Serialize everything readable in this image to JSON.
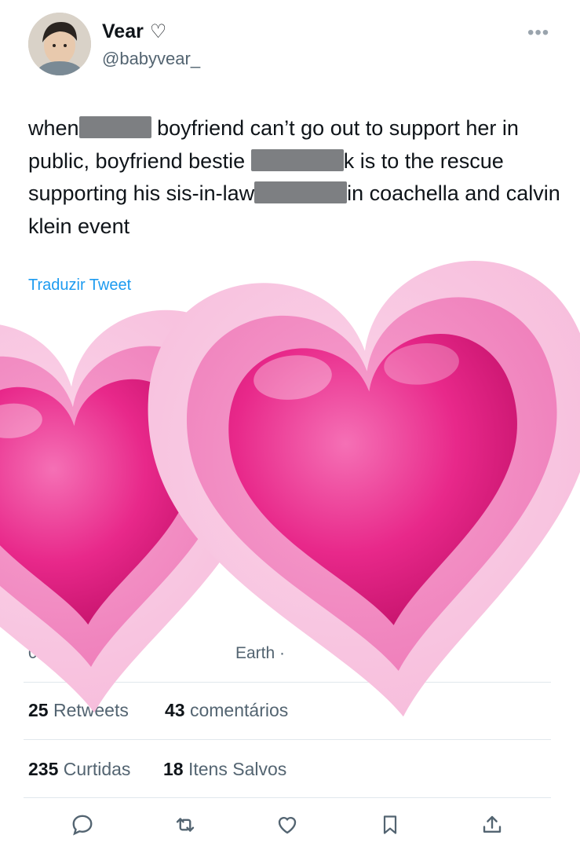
{
  "user": {
    "name": "Vear",
    "handle": "@babyvear_",
    "heart_symbol": "♡"
  },
  "more_label": "•••",
  "tweet": {
    "p1": "when",
    "p2": "boyfriend can’t go out to support her in public, boyfriend bestie",
    "p3": "k is to the rescue supporting his sis-in-law",
    "p4": "in coachella and calvin klein event"
  },
  "translate_label": "Traduzir Tweet",
  "meta": {
    "time_fragment": "07:",
    "source_fragment": "Earth ·"
  },
  "stats": {
    "retweets_count": "25",
    "retweets_label": "Retweets",
    "comments_count": "43",
    "comments_label": "comentários",
    "likes_count": "235",
    "likes_label": "Curtidas",
    "saves_count": "18",
    "saves_label": "Itens Salvos"
  },
  "actions": [
    "reply-icon",
    "retweet-icon",
    "like-icon",
    "bookmark-icon",
    "share-icon"
  ],
  "colors": {
    "link": "#1d9bf0",
    "muted": "#536471",
    "heart_pink": "#e8288a",
    "heart_outer": "#f6b8d9"
  }
}
